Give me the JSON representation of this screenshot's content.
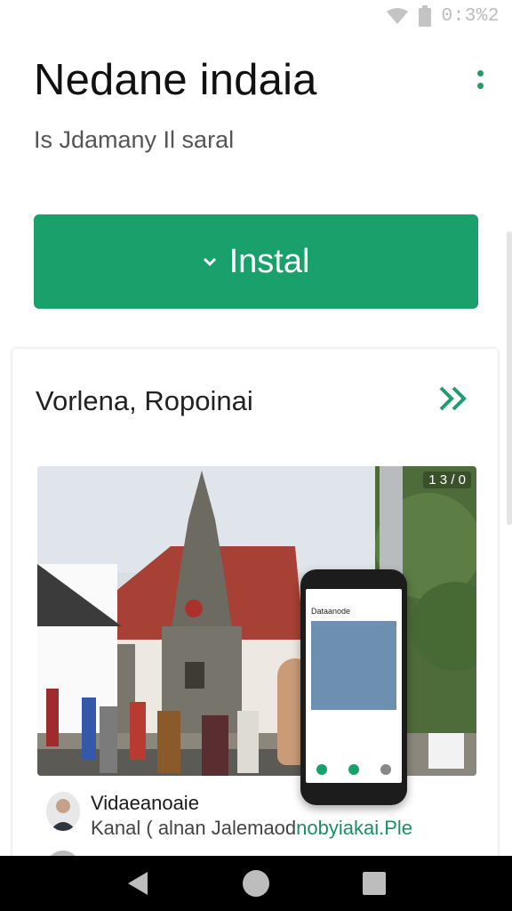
{
  "status_bar": {
    "icons": [
      "wifi-icon",
      "battery-icon"
    ],
    "clock": "0:3%2"
  },
  "header": {
    "title": "Nedane indaia",
    "subtitle": "Is Jdamany Il saral",
    "menu_icon": "more-vert-icon"
  },
  "install": {
    "label": "Instal",
    "icon": "chevron-down-icon",
    "color": "#1aa06a"
  },
  "section": {
    "title": "Vorlena, Ropoinai",
    "action_icon": "double-chevron-icon"
  },
  "media": {
    "counter": "1 3 / 0",
    "phone_title": "Dataanode"
  },
  "review": {
    "name": "Vidaeanoaie",
    "text_prefix": "Kanal ( alnan Jalemaod",
    "text_accent": "nobyiakai.Ple"
  },
  "navigation": {
    "icons": [
      "back-icon",
      "home-icon",
      "recents-icon"
    ]
  },
  "colors": {
    "accent": "#1aa06a",
    "nav_bar": "#000000"
  }
}
